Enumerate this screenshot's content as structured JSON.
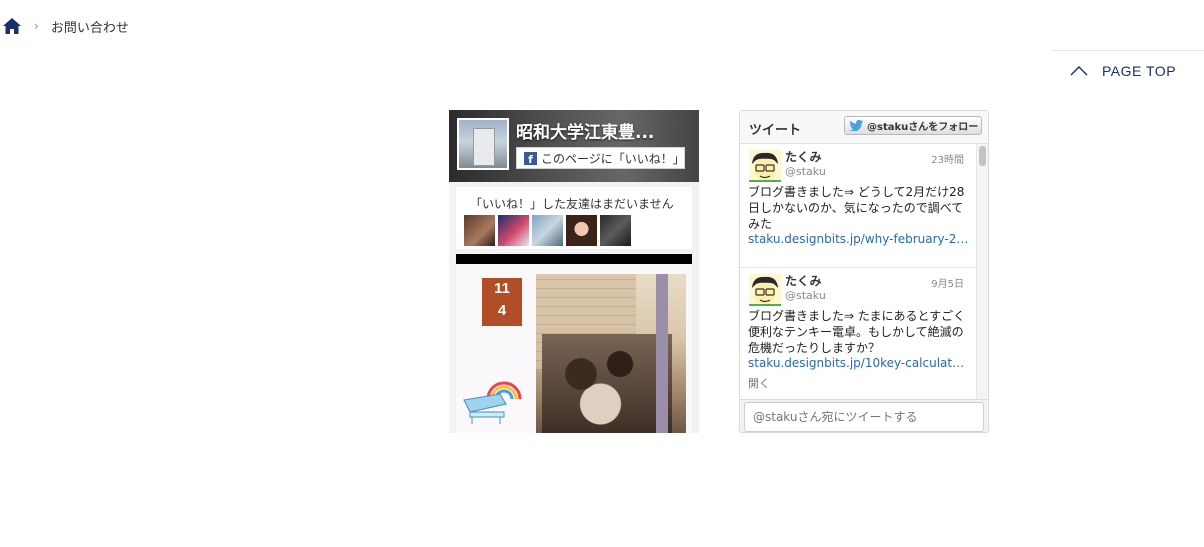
{
  "breadcrumb": {
    "home_icon": "home-icon",
    "separator": "›",
    "current": "お問い合わせ"
  },
  "page_top": {
    "label": "PAGE TOP",
    "icon": "chevron-up-icon"
  },
  "facebook": {
    "page_name": "昭和大学江東豊...",
    "like_button": "このページに「いいね！」",
    "friends_text": "「いいね！」した友達はまだいません",
    "post_date_month": "11",
    "post_date_day": "4"
  },
  "twitter": {
    "title": "ツイート",
    "follow_button": "@stakuさんをフォロー",
    "tweets": [
      {
        "user": "たくみ",
        "handle": "@staku",
        "time": "23時間",
        "text": "ブログ書きました⇒ どうして2月だけ28日しかないのか、気になったので調べてみた",
        "link": "staku.designbits.jp/why-february-2…"
      },
      {
        "user": "たくみ",
        "handle": "@staku",
        "time": "9月5日",
        "text": "ブログ書きました⇒ たまにあるとすごく便利なテンキー電卓。もしかして絶滅の危機だったりしますか？",
        "link": "staku.designbits.jp/10key-calculat…",
        "open": "開く"
      }
    ],
    "input_placeholder": "@stakuさん宛にツイートする"
  },
  "colors": {
    "brand_navy": "#1a2f6e",
    "facebook_blue": "#3b5998",
    "twitter_link": "#2a6aa8"
  }
}
